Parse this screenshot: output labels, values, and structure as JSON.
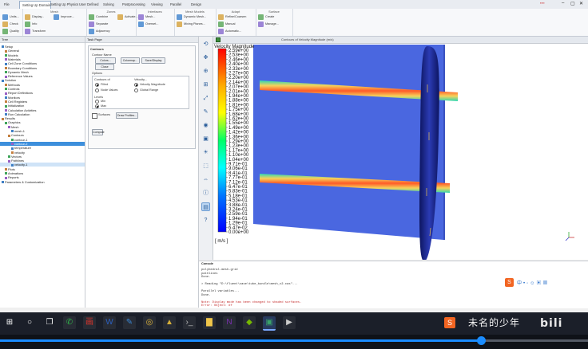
{
  "ribbon": {
    "tabs": [
      "File",
      "Setting Up Domain",
      "Setting Up Physics",
      "User Defined",
      "Solving",
      "Postprocessing",
      "Viewing",
      "Parallel",
      "Design"
    ],
    "active_tab": 1,
    "groups": [
      {
        "title": "",
        "items": [
          "Units...",
          "Check",
          "Quality"
        ]
      },
      {
        "title": "Mesh",
        "items": [
          "Display...",
          "Info",
          "Transform",
          "Improve..."
        ]
      },
      {
        "title": "Zones",
        "items": [
          "Combine",
          "Separate",
          "Adjacency",
          "Activate..."
        ]
      },
      {
        "title": "Interfaces",
        "items": [
          "Mesh...",
          "Overset..."
        ]
      },
      {
        "title": "Mesh Models",
        "items": [
          "Dynamic Mesh...",
          "Mixing Planes..."
        ]
      },
      {
        "title": "Adapt",
        "items": [
          "Refine/Coarsen",
          "Manual",
          "Automatic..."
        ]
      },
      {
        "title": "Surface",
        "items": [
          "Create",
          "Manage..."
        ]
      }
    ],
    "window_buttons": [
      "minimize",
      "restore",
      "close"
    ]
  },
  "tree": {
    "header": "Tree",
    "items": [
      {
        "label": "Setup",
        "depth": 0
      },
      {
        "label": "General",
        "depth": 1
      },
      {
        "label": "Models",
        "depth": 1
      },
      {
        "label": "Materials",
        "depth": 1
      },
      {
        "label": "Cell Zone Conditions",
        "depth": 1
      },
      {
        "label": "Boundary Conditions",
        "depth": 1
      },
      {
        "label": "Dynamic Mesh",
        "depth": 1
      },
      {
        "label": "Reference Values",
        "depth": 1
      },
      {
        "label": "Solution",
        "depth": 0
      },
      {
        "label": "Methods",
        "depth": 1
      },
      {
        "label": "Controls",
        "depth": 1
      },
      {
        "label": "Report Definitions",
        "depth": 1
      },
      {
        "label": "Monitors",
        "depth": 1
      },
      {
        "label": "Cell Registers",
        "depth": 1
      },
      {
        "label": "Initialization",
        "depth": 1
      },
      {
        "label": "Calculation Activities",
        "depth": 1
      },
      {
        "label": "Run Calculation",
        "depth": 1
      },
      {
        "label": "Results",
        "depth": 0
      },
      {
        "label": "Graphics",
        "depth": 1
      },
      {
        "label": "Mesh",
        "depth": 2
      },
      {
        "label": "mesh-1",
        "depth": 3
      },
      {
        "label": "Contours",
        "depth": 2
      },
      {
        "label": "contour-1",
        "depth": 3
      },
      {
        "label": "contour-2",
        "depth": 3,
        "selected": true
      },
      {
        "label": "temperature",
        "depth": 3
      },
      {
        "label": "velocity",
        "depth": 3
      },
      {
        "label": "Vectors",
        "depth": 2
      },
      {
        "label": "Pathlines",
        "depth": 2
      },
      {
        "label": "velocity-1",
        "depth": 3,
        "selected2": true
      },
      {
        "label": "Plots",
        "depth": 1
      },
      {
        "label": "Animations",
        "depth": 1
      },
      {
        "label": "Reports",
        "depth": 1
      },
      {
        "label": "Parameters & Customization",
        "depth": 0
      }
    ]
  },
  "task": {
    "header": "Task Page",
    "title": "Contours",
    "sections": {
      "name_label": "Contour Name",
      "buttons": [
        "Colors...",
        "Colormap...",
        "Save/Display",
        "Close"
      ],
      "options_label": "Options",
      "opt1": "Filled",
      "opt2": "Node Values",
      "opt3": "Global Range",
      "contours_of": "Contours of",
      "field1": "Velocity...",
      "field2": "Velocity Magnitude",
      "min_label": "Min",
      "max_label": "Max",
      "surfaces_label": "Surfaces",
      "draw_label": "Draw Profiles...",
      "levels": "Levels",
      "compute": "Compute"
    }
  },
  "graphics": {
    "window_title": "Contours of Velocity Magnitude (m/s)",
    "legend_title": "Velocity Magnitude",
    "legend_unit": "[ m/s ]",
    "legend_labels": [
      "2.59e+00",
      "2.53e+00",
      "2.46e+00",
      "2.40e+00",
      "2.33e+00",
      "2.27e+00",
      "2.20e+00",
      "2.14e+00",
      "2.07e+00",
      "2.01e+00",
      "1.94e+00",
      "1.88e+00",
      "1.81e+00",
      "1.75e+00",
      "1.68e+00",
      "1.62e+00",
      "1.55e+00",
      "1.49e+00",
      "1.42e+00",
      "1.36e+00",
      "1.29e+00",
      "1.23e+00",
      "1.17e+00",
      "1.10e+00",
      "1.04e+00",
      "9.71e-01",
      "9.06e-01",
      "8.41e-01",
      "7.77e-01",
      "7.12e-01",
      "6.47e-01",
      "5.83e-01",
      "5.18e-01",
      "4.53e-01",
      "3.88e-01",
      "3.24e-01",
      "2.59e-01",
      "1.94e-01",
      "1.29e-01",
      "6.47e-02",
      "0.00e+00"
    ],
    "toolbar_icons": [
      "rotate-icon",
      "pan-icon",
      "zoom-icon",
      "zoom-box-icon",
      "fit-icon",
      "probe-icon",
      "view-icon",
      "camera-icon",
      "light-icon",
      "select-icon",
      "ruler-icon",
      "info-icon",
      "graph-icon",
      "help-icon"
    ],
    "colors": {
      "bg": "#ffffff",
      "wall": "#4a67e0",
      "band_edge": "#2bd8b4",
      "band_mid": "#f7d15a",
      "band_core": "#ff5a28",
      "rod": "#1e2a8a"
    }
  },
  "console": {
    "header": "Console",
    "lines": [
      {
        "text": "  polyhedral-mesh-grid",
        "color": "#333"
      },
      {
        "text": "  pathlines",
        "color": "#333"
      },
      {
        "text": "Done.",
        "color": "#333"
      },
      {
        "text": "",
        "color": "#333"
      },
      {
        "text": "> Reading \"D:\\fluent\\case\\tube_bundle\\mesh_v2.cas\"...",
        "color": "#333"
      },
      {
        "text": "",
        "color": "#333"
      },
      {
        "text": "Parallel variables...",
        "color": "#333"
      },
      {
        "text": "Done.",
        "color": "#333"
      },
      {
        "text": "",
        "color": "#333"
      },
      {
        "text": "Note: Display mode has been changed to shaded surfaces.",
        "color": "#c42b2b"
      },
      {
        "text": "Error: Object: #f",
        "color": "#c42b2b"
      }
    ]
  },
  "taskbar": {
    "overlay_text": "未名的少年",
    "icons": [
      "windows-start-icon",
      "search-icon",
      "task-view-icon",
      "wechat-icon",
      "app-red-icon",
      "word-icon",
      "app-blue-icon",
      "chrome-icon",
      "app-yellow-icon",
      "terminal-icon",
      "file-explorer-icon",
      "onenote-icon",
      "nvidia-icon",
      "fluent-icon",
      "video-icon"
    ]
  }
}
